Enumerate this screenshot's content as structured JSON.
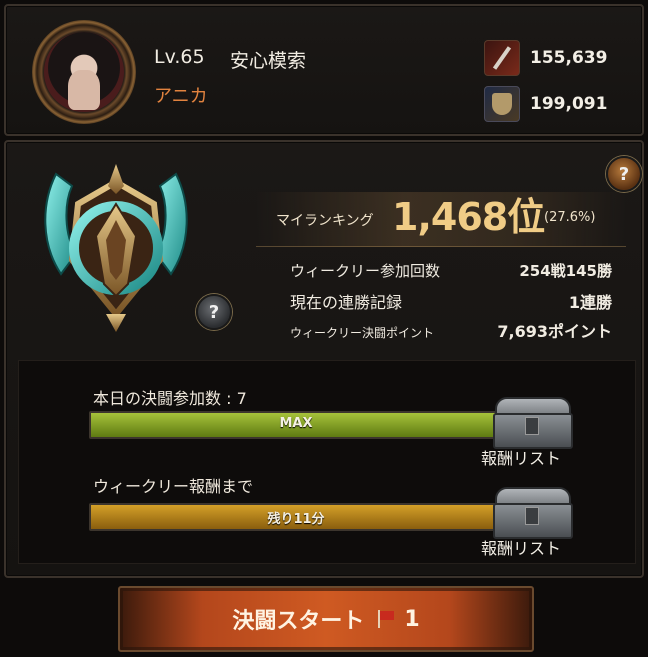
{
  "player": {
    "level": "Lv.65",
    "name": "安心模索",
    "class": "アニカ",
    "attack": "155,639",
    "defense": "199,091"
  },
  "ranking": {
    "label": "マイランキング",
    "value": "1,468位",
    "percent": "(27.6%)",
    "help": "?"
  },
  "stats": [
    {
      "key": "ウィークリー参加回数",
      "value": "254戦145勝"
    },
    {
      "key": "現在の連勝記録",
      "value": "1連勝"
    },
    {
      "key": "ウィークリー決闘ポイント",
      "value": "7,693ポイント"
    }
  ],
  "emblem_help": "?",
  "rewards": {
    "daily": {
      "label": "本日の決闘参加数 : 7",
      "bar_text": "MAX",
      "progress": 1.0,
      "link": "報酬リスト"
    },
    "weekly": {
      "label": "ウィークリー報酬まで",
      "bar_text": "残り11分",
      "progress": 1.0,
      "link": "報酬リスト"
    }
  },
  "start_button": {
    "label": "決闘スタート",
    "count": "1"
  },
  "colors": {
    "accent_gold": "#f0cc86",
    "class_orange": "#e2833f",
    "daily_bar": "#8fae2c",
    "weekly_bar": "#c0901e",
    "start_button": "#cf5a22"
  }
}
